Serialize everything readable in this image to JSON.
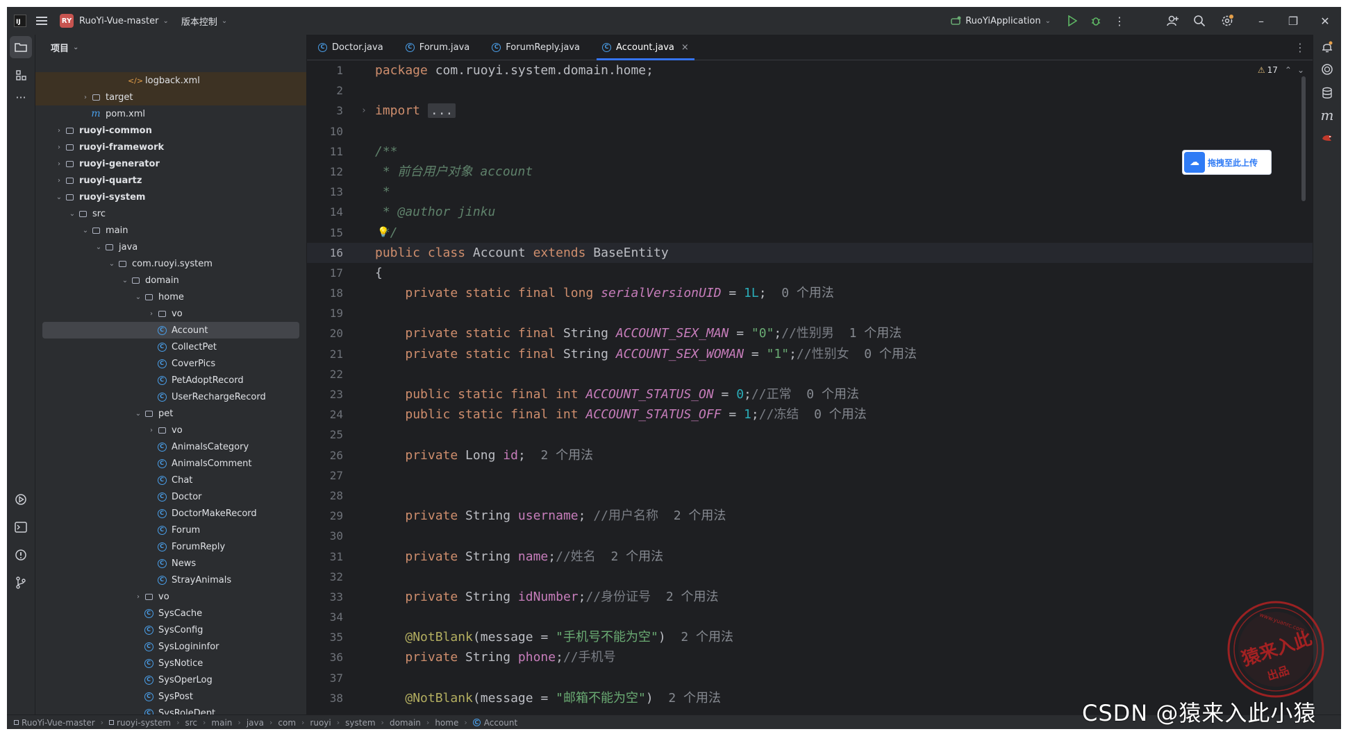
{
  "titlebar": {
    "project_badge": "RY",
    "project_name": "RuoYi-Vue-master",
    "vcs_menu": "版本控制",
    "run_config": "RuoYiApplication"
  },
  "project_panel": {
    "header": "项目",
    "tree": [
      {
        "label": "logback.xml",
        "type": "xml",
        "indent": 6,
        "arrow": ""
      },
      {
        "label": "target",
        "type": "folder",
        "indent": 3,
        "arrow": "›"
      },
      {
        "label": "pom.xml",
        "type": "maven",
        "indent": 3,
        "arrow": ""
      },
      {
        "label": "ruoyi-common",
        "type": "module",
        "indent": 1,
        "arrow": "›",
        "bold": true
      },
      {
        "label": "ruoyi-framework",
        "type": "module",
        "indent": 1,
        "arrow": "›",
        "bold": true
      },
      {
        "label": "ruoyi-generator",
        "type": "module",
        "indent": 1,
        "arrow": "›",
        "bold": true
      },
      {
        "label": "ruoyi-quartz",
        "type": "module",
        "indent": 1,
        "arrow": "›",
        "bold": true
      },
      {
        "label": "ruoyi-system",
        "type": "module",
        "indent": 1,
        "arrow": "⌄",
        "bold": true
      },
      {
        "label": "src",
        "type": "folder",
        "indent": 2,
        "arrow": "⌄"
      },
      {
        "label": "main",
        "type": "folder",
        "indent": 3,
        "arrow": "⌄"
      },
      {
        "label": "java",
        "type": "folder",
        "indent": 4,
        "arrow": "⌄"
      },
      {
        "label": "com.ruoyi.system",
        "type": "package",
        "indent": 5,
        "arrow": "⌄"
      },
      {
        "label": "domain",
        "type": "package",
        "indent": 6,
        "arrow": "⌄"
      },
      {
        "label": "home",
        "type": "package",
        "indent": 7,
        "arrow": "⌄"
      },
      {
        "label": "vo",
        "type": "package",
        "indent": 8,
        "arrow": "›"
      },
      {
        "label": "Account",
        "type": "class",
        "indent": 8,
        "arrow": "",
        "selected": true
      },
      {
        "label": "CollectPet",
        "type": "class",
        "indent": 8,
        "arrow": ""
      },
      {
        "label": "CoverPics",
        "type": "class",
        "indent": 8,
        "arrow": ""
      },
      {
        "label": "PetAdoptRecord",
        "type": "class",
        "indent": 8,
        "arrow": ""
      },
      {
        "label": "UserRechargeRecord",
        "type": "class",
        "indent": 8,
        "arrow": ""
      },
      {
        "label": "pet",
        "type": "package",
        "indent": 7,
        "arrow": "⌄"
      },
      {
        "label": "vo",
        "type": "package",
        "indent": 8,
        "arrow": "›"
      },
      {
        "label": "AnimalsCategory",
        "type": "class",
        "indent": 8,
        "arrow": ""
      },
      {
        "label": "AnimalsComment",
        "type": "class",
        "indent": 8,
        "arrow": ""
      },
      {
        "label": "Chat",
        "type": "class",
        "indent": 8,
        "arrow": ""
      },
      {
        "label": "Doctor",
        "type": "class",
        "indent": 8,
        "arrow": ""
      },
      {
        "label": "DoctorMakeRecord",
        "type": "class",
        "indent": 8,
        "arrow": ""
      },
      {
        "label": "Forum",
        "type": "class",
        "indent": 8,
        "arrow": ""
      },
      {
        "label": "ForumReply",
        "type": "class",
        "indent": 8,
        "arrow": ""
      },
      {
        "label": "News",
        "type": "class",
        "indent": 8,
        "arrow": ""
      },
      {
        "label": "StrayAnimals",
        "type": "class",
        "indent": 8,
        "arrow": ""
      },
      {
        "label": "vo",
        "type": "package",
        "indent": 7,
        "arrow": "›"
      },
      {
        "label": "SysCache",
        "type": "class",
        "indent": 7,
        "arrow": ""
      },
      {
        "label": "SysConfig",
        "type": "class",
        "indent": 7,
        "arrow": ""
      },
      {
        "label": "SysLogininfor",
        "type": "class",
        "indent": 7,
        "arrow": ""
      },
      {
        "label": "SysNotice",
        "type": "class",
        "indent": 7,
        "arrow": ""
      },
      {
        "label": "SysOperLog",
        "type": "class",
        "indent": 7,
        "arrow": ""
      },
      {
        "label": "SysPost",
        "type": "class",
        "indent": 7,
        "arrow": ""
      },
      {
        "label": "SysRoleDept",
        "type": "class",
        "indent": 7,
        "arrow": ""
      }
    ]
  },
  "editor": {
    "tabs": [
      {
        "label": "Doctor.java",
        "active": false
      },
      {
        "label": "Forum.java",
        "active": false
      },
      {
        "label": "ForumReply.java",
        "active": false
      },
      {
        "label": "Account.java",
        "active": true
      }
    ],
    "close_label": "×",
    "inspection_count": "17",
    "lines": [
      {
        "n": "1",
        "html": "<span class=\"kw\">package</span> com.ruoyi.system.domain.home;"
      },
      {
        "n": "2",
        "html": ""
      },
      {
        "n": "3",
        "html": "<span class=\"kw\">import</span> <span class=\"fold-box\">...</span>",
        "fold": true
      },
      {
        "n": "10",
        "html": ""
      },
      {
        "n": "11",
        "html": "<span class=\"doc\">/**</span>"
      },
      {
        "n": "12",
        "html": "<span class=\"doc\"> * 前台用户对象 account</span>"
      },
      {
        "n": "13",
        "html": "<span class=\"doc\"> *</span>"
      },
      {
        "n": "14",
        "html": "<span class=\"doc\"> * @author jinku</span>"
      },
      {
        "n": "15",
        "html": "<span class=\"doc\"> */</span>"
      },
      {
        "n": "16",
        "html": "<span class=\"kw\">public class</span> Account <span class=\"kw\">extends</span> BaseEntity",
        "current": true
      },
      {
        "n": "17",
        "html": "{"
      },
      {
        "n": "18",
        "html": "    <span class=\"kw\">private static final long</span> <span class=\"sfi\">serialVersionUID</span> = <span class=\"num\">1L</span>;  <span class=\"hint\">0 个用法</span>"
      },
      {
        "n": "19",
        "html": ""
      },
      {
        "n": "20",
        "html": "    <span class=\"kw\">private static final</span> String <span class=\"sfi\">ACCOUNT_SEX_MAN</span> = <span class=\"str\">\"0\"</span>;<span class=\"cmt\">//性别男</span>  <span class=\"hint\">1 个用法</span>"
      },
      {
        "n": "21",
        "html": "    <span class=\"kw\">private static final</span> String <span class=\"sfi\">ACCOUNT_SEX_WOMAN</span> = <span class=\"str\">\"1\"</span>;<span class=\"cmt\">//性别女</span>  <span class=\"hint\">0 个用法</span>"
      },
      {
        "n": "22",
        "html": ""
      },
      {
        "n": "23",
        "html": "    <span class=\"kw\">public static final int</span> <span class=\"sfi\">ACCOUNT_STATUS_ON</span> = <span class=\"num\">0</span>;<span class=\"cmt\">//正常</span>  <span class=\"hint\">0 个用法</span>"
      },
      {
        "n": "24",
        "html": "    <span class=\"kw\">public static final int</span> <span class=\"sfi\">ACCOUNT_STATUS_OFF</span> = <span class=\"num\">1</span>;<span class=\"cmt\">//冻结</span>  <span class=\"hint\">0 个用法</span>"
      },
      {
        "n": "25",
        "html": ""
      },
      {
        "n": "26",
        "html": "    <span class=\"kw\">private</span> Long <span class=\"fld\">id</span>;  <span class=\"hint\">2 个用法</span>"
      },
      {
        "n": "27",
        "html": ""
      },
      {
        "n": "28",
        "html": ""
      },
      {
        "n": "29",
        "html": "    <span class=\"kw\">private</span> String <span class=\"fld\">username</span>; <span class=\"cmt\">//用户名称</span>  <span class=\"hint\">2 个用法</span>"
      },
      {
        "n": "30",
        "html": ""
      },
      {
        "n": "31",
        "html": "    <span class=\"kw\">private</span> String <span class=\"fld\">name</span>;<span class=\"cmt\">//姓名</span>  <span class=\"hint\">2 个用法</span>"
      },
      {
        "n": "32",
        "html": ""
      },
      {
        "n": "33",
        "html": "    <span class=\"kw\">private</span> String <span class=\"fld\">idNumber</span>;<span class=\"cmt\">//身份证号</span>  <span class=\"hint\">2 个用法</span>"
      },
      {
        "n": "34",
        "html": ""
      },
      {
        "n": "35",
        "html": "    <span class=\"ann\">@NotBlank</span>(message = <span class=\"str\">\"手机号不能为空\"</span>)  <span class=\"hint\">2 个用法</span>"
      },
      {
        "n": "36",
        "html": "    <span class=\"kw\">private</span> String <span class=\"fld\">phone</span>;<span class=\"cmt\">//手机号</span>"
      },
      {
        "n": "37",
        "html": ""
      },
      {
        "n": "38",
        "html": "    <span class=\"ann\">@NotBlank</span>(message = <span class=\"str\">\"邮箱不能为空\"</span>)  <span class=\"hint\">2 个用法</span>"
      }
    ]
  },
  "upload_button": {
    "label": "拖拽至此上传"
  },
  "statusbar": {
    "breadcrumbs": [
      "RuoYi-Vue-master",
      "ruoyi-system",
      "src",
      "main",
      "java",
      "com",
      "ruoyi",
      "system",
      "domain",
      "home",
      "Account"
    ]
  },
  "watermark": {
    "text": "CSDN @猿来入此小猿",
    "seal_text": "猿来入此",
    "seal_sub": "出品",
    "seal_url": "www.yuanrc.com"
  },
  "colors": {
    "accent": "#3574f0",
    "keyword": "#cf8e6d",
    "string": "#6aab73",
    "field": "#c77dbb",
    "comment": "#7a7e85"
  }
}
